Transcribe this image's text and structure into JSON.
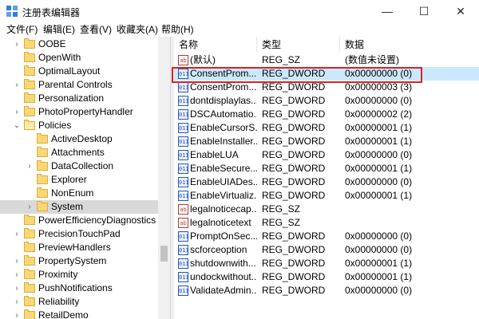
{
  "window": {
    "title": "注册表编辑器",
    "controls": {
      "minimize": "—",
      "maximize": "☐",
      "close": "✕"
    }
  },
  "menu": [
    "文件(F)",
    "编辑(E)",
    "查看(V)",
    "收藏夹(A)",
    "帮助(H)"
  ],
  "tree": [
    {
      "label": "OOBE",
      "depth": 1,
      "expander": "collapsed"
    },
    {
      "label": "OpenWith",
      "depth": 1,
      "expander": "none"
    },
    {
      "label": "OptimalLayout",
      "depth": 1,
      "expander": "none"
    },
    {
      "label": "Parental Controls",
      "depth": 1,
      "expander": "collapsed"
    },
    {
      "label": "Personalization",
      "depth": 1,
      "expander": "none"
    },
    {
      "label": "PhotoPropertyHandler",
      "depth": 1,
      "expander": "collapsed"
    },
    {
      "label": "Policies",
      "depth": 1,
      "expander": "expanded"
    },
    {
      "label": "ActiveDesktop",
      "depth": 2,
      "expander": "none"
    },
    {
      "label": "Attachments",
      "depth": 2,
      "expander": "none"
    },
    {
      "label": "DataCollection",
      "depth": 2,
      "expander": "collapsed"
    },
    {
      "label": "Explorer",
      "depth": 2,
      "expander": "none"
    },
    {
      "label": "NonEnum",
      "depth": 2,
      "expander": "none"
    },
    {
      "label": "System",
      "depth": 2,
      "expander": "collapsed",
      "selected": true
    },
    {
      "label": "PowerEfficiencyDiagnostics",
      "depth": 1,
      "expander": "none"
    },
    {
      "label": "PrecisionTouchPad",
      "depth": 1,
      "expander": "collapsed"
    },
    {
      "label": "PreviewHandlers",
      "depth": 1,
      "expander": "none"
    },
    {
      "label": "PropertySystem",
      "depth": 1,
      "expander": "collapsed"
    },
    {
      "label": "Proximity",
      "depth": 1,
      "expander": "collapsed"
    },
    {
      "label": "PushNotifications",
      "depth": 1,
      "expander": "collapsed"
    },
    {
      "label": "Reliability",
      "depth": 1,
      "expander": "collapsed"
    },
    {
      "label": "RetailDemo",
      "depth": 1,
      "expander": "collapsed"
    }
  ],
  "list": {
    "columns": {
      "name": "名称",
      "type": "类型",
      "data": "数据"
    },
    "rows": [
      {
        "name": "(默认)",
        "type": "REG_SZ",
        "data": "(数值未设置)",
        "icon": "string-value-icon"
      },
      {
        "name": "ConsentProm...",
        "type": "REG_DWORD",
        "data": "0x00000000 (0)",
        "icon": "dword-value-icon",
        "highlighted": true
      },
      {
        "name": "ConsentProm...",
        "type": "REG_DWORD",
        "data": "0x00000003 (3)",
        "icon": "dword-value-icon"
      },
      {
        "name": "dontdisplaylas...",
        "type": "REG_DWORD",
        "data": "0x00000000 (0)",
        "icon": "dword-value-icon"
      },
      {
        "name": "DSCAutomatio...",
        "type": "REG_DWORD",
        "data": "0x00000002 (2)",
        "icon": "dword-value-icon"
      },
      {
        "name": "EnableCursorS...",
        "type": "REG_DWORD",
        "data": "0x00000001 (1)",
        "icon": "dword-value-icon"
      },
      {
        "name": "EnableInstaller...",
        "type": "REG_DWORD",
        "data": "0x00000001 (1)",
        "icon": "dword-value-icon"
      },
      {
        "name": "EnableLUA",
        "type": "REG_DWORD",
        "data": "0x00000000 (0)",
        "icon": "dword-value-icon"
      },
      {
        "name": "EnableSecure...",
        "type": "REG_DWORD",
        "data": "0x00000001 (1)",
        "icon": "dword-value-icon"
      },
      {
        "name": "EnableUIADes...",
        "type": "REG_DWORD",
        "data": "0x00000000 (0)",
        "icon": "dword-value-icon"
      },
      {
        "name": "EnableVirtualiz...",
        "type": "REG_DWORD",
        "data": "0x00000001 (1)",
        "icon": "dword-value-icon"
      },
      {
        "name": "legalnoticecap...",
        "type": "REG_SZ",
        "data": "",
        "icon": "string-value-icon"
      },
      {
        "name": "legalnoticetext",
        "type": "REG_SZ",
        "data": "",
        "icon": "string-value-icon"
      },
      {
        "name": "PromptOnSec...",
        "type": "REG_DWORD",
        "data": "0x00000000 (0)",
        "icon": "dword-value-icon"
      },
      {
        "name": "scforceoption",
        "type": "REG_DWORD",
        "data": "0x00000000 (0)",
        "icon": "dword-value-icon"
      },
      {
        "name": "shutdownwith...",
        "type": "REG_DWORD",
        "data": "0x00000001 (1)",
        "icon": "dword-value-icon"
      },
      {
        "name": "undockwithout...",
        "type": "REG_DWORD",
        "data": "0x00000001 (1)",
        "icon": "dword-value-icon"
      },
      {
        "name": "ValidateAdmin...",
        "type": "REG_DWORD",
        "data": "0x00000000 (0)",
        "icon": "dword-value-icon"
      }
    ]
  },
  "icon_text": {
    "string": "ab",
    "dword": "011"
  },
  "colors": {
    "highlight_box": "#e02020",
    "selected_row": "#cce8ff",
    "tree_selected": "#d9d9d9",
    "folder": "#f8d775"
  }
}
